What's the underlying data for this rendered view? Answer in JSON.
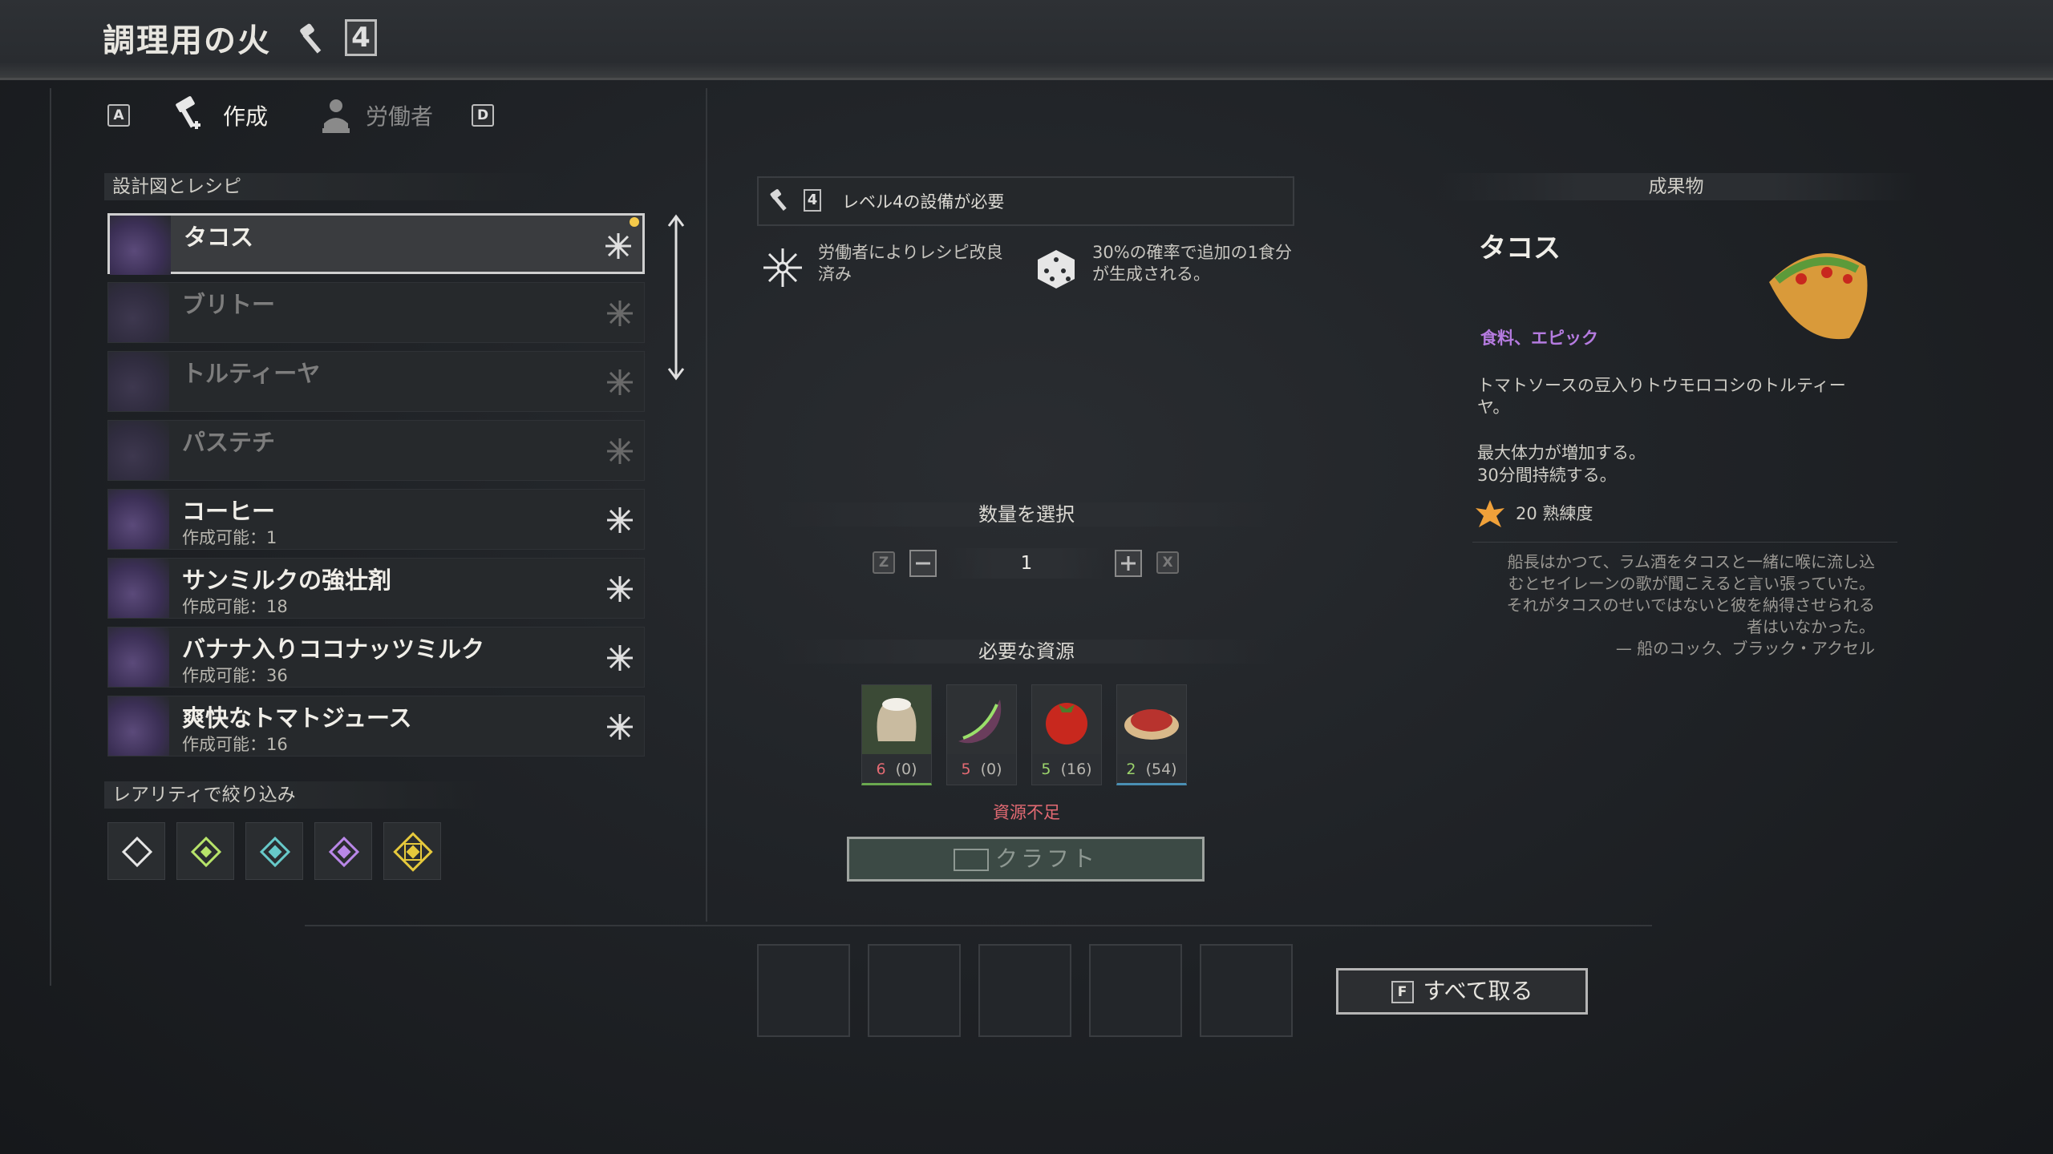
{
  "header": {
    "station_name": "調理用の火",
    "station_level": "4",
    "tab_key_left": "A",
    "tab_key_right": "D",
    "tabs": [
      {
        "label": "作成",
        "active": true
      },
      {
        "label": "労働者",
        "active": false
      }
    ]
  },
  "recipes_panel": {
    "title": "設計図とレシピ",
    "items": [
      {
        "name": "タコス",
        "sub": "",
        "selected": true,
        "available": true
      },
      {
        "name": "ブリトー",
        "sub": "",
        "selected": false,
        "available": false
      },
      {
        "name": "トルティーヤ",
        "sub": "",
        "selected": false,
        "available": false
      },
      {
        "name": "パステチ",
        "sub": "",
        "selected": false,
        "available": false
      },
      {
        "name": "コーヒー",
        "sub": "作成可能：1",
        "selected": false,
        "available": true
      },
      {
        "name": "サンミルクの強壮剤",
        "sub": "作成可能：18",
        "selected": false,
        "available": true
      },
      {
        "name": "バナナ入りココナッツミルク",
        "sub": "作成可能：36",
        "selected": false,
        "available": true
      },
      {
        "name": "爽快なトマトジュース",
        "sub": "作成可能：16",
        "selected": false,
        "available": true
      }
    ],
    "filter_title": "レアリティで絞り込み",
    "filter_colors": [
      "#e6e6e6",
      "#b7e36a",
      "#67c9c9",
      "#b987e8",
      "#e6c93c"
    ]
  },
  "requirements": {
    "level_text": "レベル4の設備が必要",
    "level_box": "4",
    "perk1": "労働者によりレシピ改良済み",
    "perk2": "30%の確率で追加の1食分が生成される。"
  },
  "quantity": {
    "title": "数量を選択",
    "key_minus": "Z",
    "key_plus": "X",
    "value": "1"
  },
  "resources": {
    "title": "必要な資源",
    "items": [
      {
        "name": "flour-sack",
        "need": "6",
        "have": "(0)",
        "enough": false,
        "color": "#6aa84f"
      },
      {
        "name": "bean-pod",
        "need": "5",
        "have": "(0)",
        "enough": false,
        "color": "#3b3e42"
      },
      {
        "name": "tomato",
        "need": "5",
        "have": "(16)",
        "enough": true,
        "color": "#3b3e42"
      },
      {
        "name": "meat-bowl",
        "need": "2",
        "have": "(54)",
        "enough": true,
        "color": "#4a8fb3"
      }
    ],
    "warning": "資源不足",
    "craft_label": "クラフト"
  },
  "take_all": {
    "key": "F",
    "label": "すべて取る"
  },
  "output": {
    "section_title": "成果物",
    "name": "タコス",
    "tags": "食料、エピック",
    "description": "トマトソースの豆入りトウモロコシのトルティーヤ。",
    "effect_line1": "最大体力が増加する。",
    "effect_line2": "30分間持続する。",
    "mastery": "20 熟練度",
    "quote_line1": "船長はかつて、ラム酒をタコスと一緒に喉に流し込",
    "quote_line2": "むとセイレーンの歌が聞こえると言い張っていた。",
    "quote_line3": "それがタコスのせいではないと彼を納得させられる",
    "quote_line4": "者はいなかった。",
    "quote_author": "— 船のコック、ブラック・アクセル",
    "accent_color": "#b57be0"
  }
}
